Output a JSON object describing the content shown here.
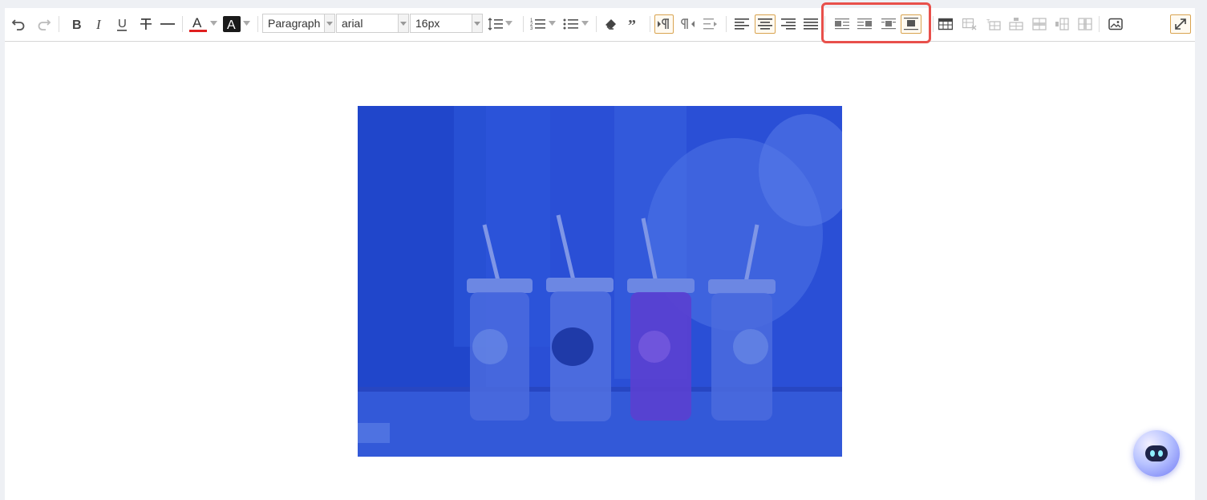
{
  "toolbar": {
    "block_format": "Paragraph",
    "font_family": "arial",
    "font_size": "16px",
    "font_color": "#e02020",
    "highlight_color": "#1a1a1a",
    "active_buttons": [
      "image-float-none",
      "align-center"
    ],
    "annotation_color": "#e8504b"
  },
  "image": {
    "tint_color": "#2a4fd6",
    "subject_icons": [
      "jar-with-straw",
      "jar-with-straw",
      "jar-with-straw",
      "jar-with-straw"
    ]
  },
  "assistant": {
    "icon": "robot-icon"
  }
}
